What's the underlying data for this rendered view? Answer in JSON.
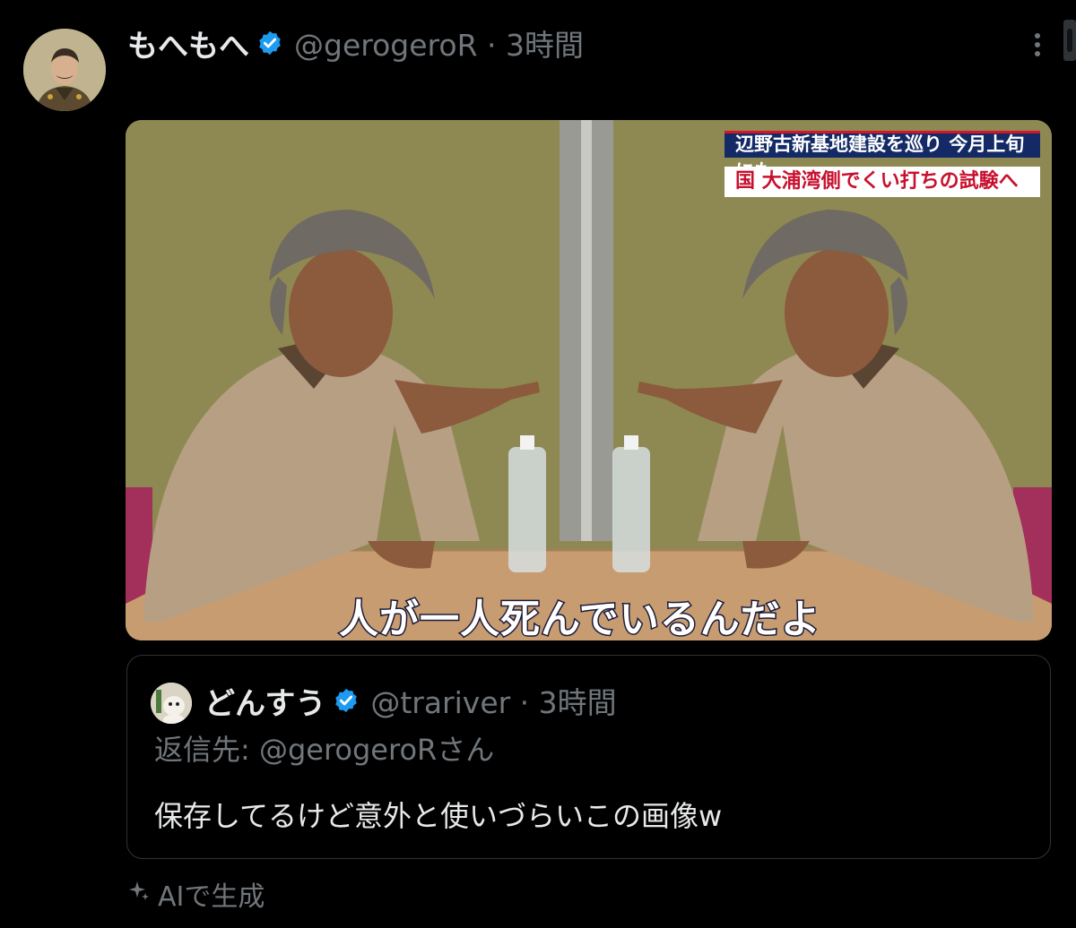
{
  "post": {
    "display_name": "もへもへ",
    "handle_time": "@gerogeroR · 3時間",
    "verified": true,
    "more_icon": "more-vertical-icon"
  },
  "media": {
    "news_ticker_top": "辺野古新基地建設を巡り 今月上旬にも",
    "news_ticker_bottom": "国 大浦湾側でくい打ちの試験へ",
    "subtitle": "人が一人死んでいるんだよ",
    "colors": {
      "wall": "#8e8952",
      "shirt": "#b79f84",
      "table": "#c79c70",
      "ticker_navy": "#132a66",
      "ticker_red": "#c8102e"
    }
  },
  "quoted_post": {
    "display_name": "どんすう",
    "handle_time": "@trariver · 3時間",
    "verified": true,
    "reply_to": "返信先: @gerogeroRさん",
    "text": "保存してるけど意外と使いづらいこの画像w"
  },
  "footer": {
    "ai_label": "AIで生成",
    "ai_icon": "sparkle-icon"
  },
  "colors": {
    "background": "#000000",
    "text": "#e7e9ea",
    "muted": "#71767b",
    "verified": "#1d9bf0",
    "border": "#2f3336"
  }
}
